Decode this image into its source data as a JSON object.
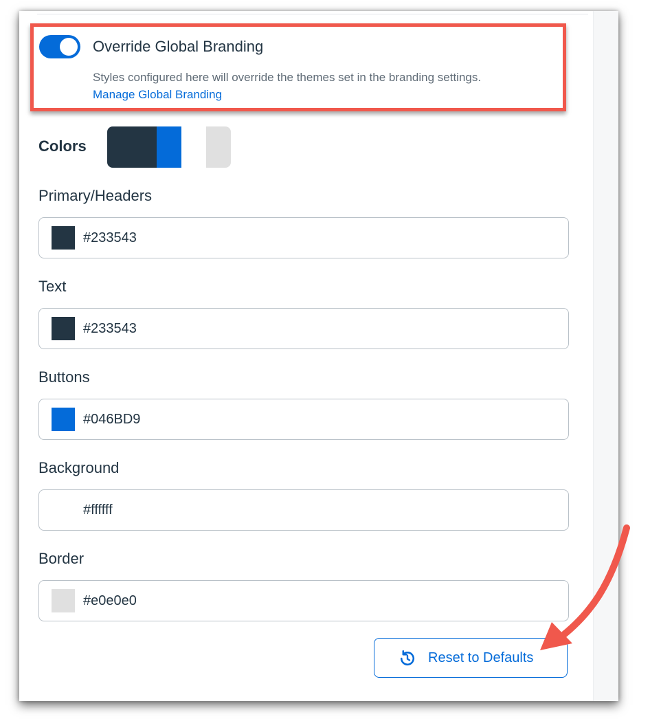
{
  "override": {
    "title": "Override Global Branding",
    "description": "Styles configured here will override the themes set in the branding settings.",
    "link": "Manage Global Branding",
    "enabled": true
  },
  "colors_label": "Colors",
  "fields": [
    {
      "label": "Primary/Headers",
      "value": "#233543",
      "swatch": "#233543"
    },
    {
      "label": "Text",
      "value": "#233543",
      "swatch": "#233543"
    },
    {
      "label": "Buttons",
      "value": "#046BD9",
      "swatch": "#046BD9"
    },
    {
      "label": "Background",
      "value": "#ffffff",
      "swatch": "#ffffff"
    },
    {
      "label": "Border",
      "value": "#e0e0e0",
      "swatch": "#e0e0e0"
    }
  ],
  "reset_button": "Reset to Defaults",
  "accent": "#046BD9",
  "annotation_color": "#f0584c"
}
